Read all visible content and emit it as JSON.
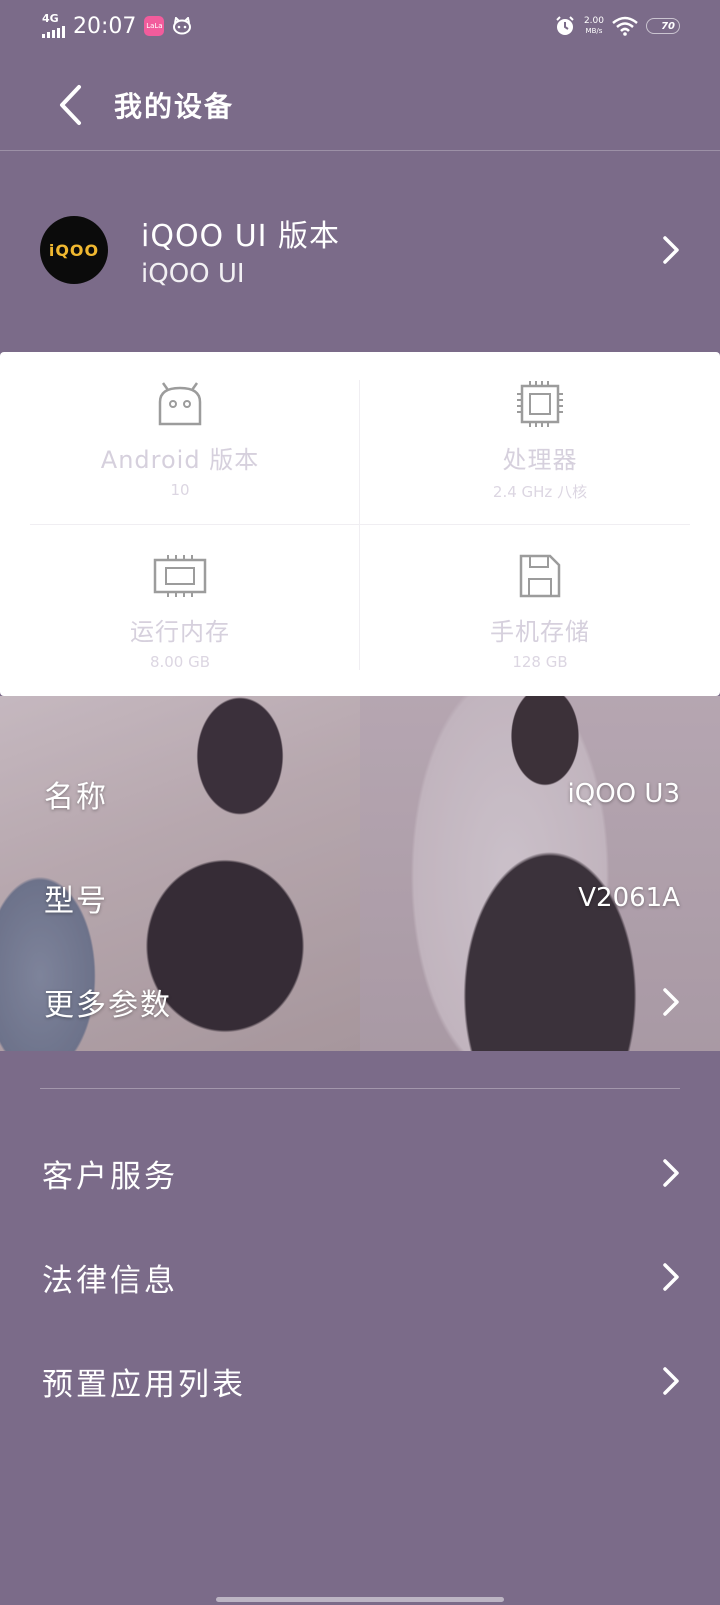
{
  "status_bar": {
    "network": "4G",
    "time": "20:07",
    "app_badge": "LaLa",
    "speed_value": "2.00",
    "speed_unit": "MB/s",
    "battery": "70"
  },
  "header": {
    "title": "我的设备"
  },
  "os": {
    "title": "iQOO UI 版本",
    "subtitle": "iQOO UI",
    "logo_text": "iQOO"
  },
  "specs": [
    {
      "icon": "android-icon",
      "label": "Android 版本",
      "value": "10"
    },
    {
      "icon": "processor-icon",
      "label": "处理器",
      "value": "2.4 GHz 八核"
    },
    {
      "icon": "memory-icon",
      "label": "运行内存",
      "value": "8.00 GB"
    },
    {
      "icon": "storage-icon",
      "label": "手机存储",
      "value": "128 GB"
    }
  ],
  "params": {
    "name_label": "名称",
    "name_value": "iQOO U3",
    "model_label": "型号",
    "model_value": "V2061A",
    "more_label": "更多参数"
  },
  "menu": [
    {
      "label": "客户服务"
    },
    {
      "label": "法律信息"
    },
    {
      "label": "预置应用列表"
    }
  ],
  "colors": {
    "background": "#7b6b89",
    "card": "#ffffff",
    "logo_accent": "#f0b830"
  }
}
